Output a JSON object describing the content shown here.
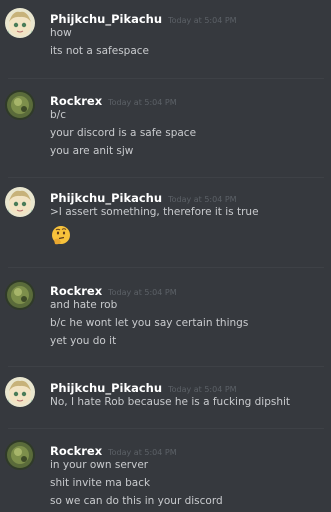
{
  "messages": [
    {
      "username": "Phijkchu_Pikachu",
      "timestamp": "Today at 5:04 PM",
      "lines": [
        "how",
        "its not a safespace"
      ],
      "avatar": "pikachu-avatar"
    },
    {
      "username": "Rockrex",
      "timestamp": "Today at 5:04 PM",
      "lines": [
        "b/c",
        "your discord is a safe space",
        "you are anit sjw"
      ],
      "avatar": "rockrex-avatar"
    },
    {
      "username": "Phijkchu_Pikachu",
      "timestamp": "Today at 5:04 PM",
      "lines": [
        ">I assert something, therefore it is true"
      ],
      "emoji": "thinking-face-emoji",
      "avatar": "pikachu-avatar"
    },
    {
      "username": "Rockrex",
      "timestamp": "Today at 5:04 PM",
      "lines": [
        "and hate rob",
        "b/c he wont let you say certain things",
        "yet you do it"
      ],
      "avatar": "rockrex-avatar"
    },
    {
      "username": "Phijkchu_Pikachu",
      "timestamp": "Today at 5:04 PM",
      "lines": [
        "No, I hate Rob because he is a fucking dipshit"
      ],
      "avatar": "pikachu-avatar"
    },
    {
      "username": "Rockrex",
      "timestamp": "Today at 5:04 PM",
      "lines": [
        "in your own server",
        "shit invite ma back",
        "so we can do this in your discord"
      ],
      "avatar": "rockrex-avatar"
    }
  ],
  "colors": {
    "background": "#36393e",
    "username": "#ffffff",
    "timestamp": "#5c6167",
    "message_text": "#c9cbce"
  }
}
